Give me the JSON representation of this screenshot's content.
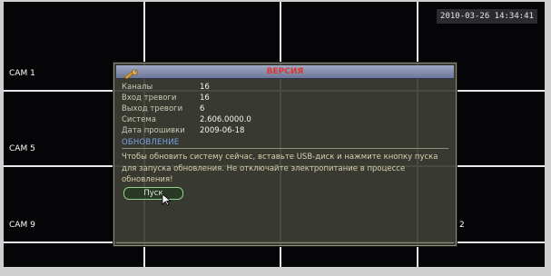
{
  "datetime": "2010-03-26 14:34:41",
  "cameras": {
    "cam1": "CAM 1",
    "cam5": "CAM 5",
    "cam9": "CAM 9",
    "partial_label": "2"
  },
  "dialog": {
    "title": "ВЕРСИЯ",
    "info": [
      {
        "label": "Каналы",
        "value": "16"
      },
      {
        "label": "Вход тревоги",
        "value": "16"
      },
      {
        "label": "Выход тревоги",
        "value": "6"
      },
      {
        "label": "Система",
        "value": "2.606.0000.0"
      },
      {
        "label": "Дата прошивки",
        "value": "2009-06-18"
      }
    ],
    "update_heading": "ОБНОВЛЕНИЕ",
    "update_message": "Чтобы обновить систему сейчас, вставьте USB-диск и нажмите кнопку пуска для запуска обновления. Не отключайте электропитание в процессе обновления!",
    "start_button": "Пуск"
  },
  "colors": {
    "title_text": "#d9382f",
    "heading_text": "#7aa0e8",
    "button_border": "#8fd08a"
  },
  "icons": {
    "dialog_icon": "wrench-icon",
    "cursor": "mouse-cursor-icon"
  }
}
